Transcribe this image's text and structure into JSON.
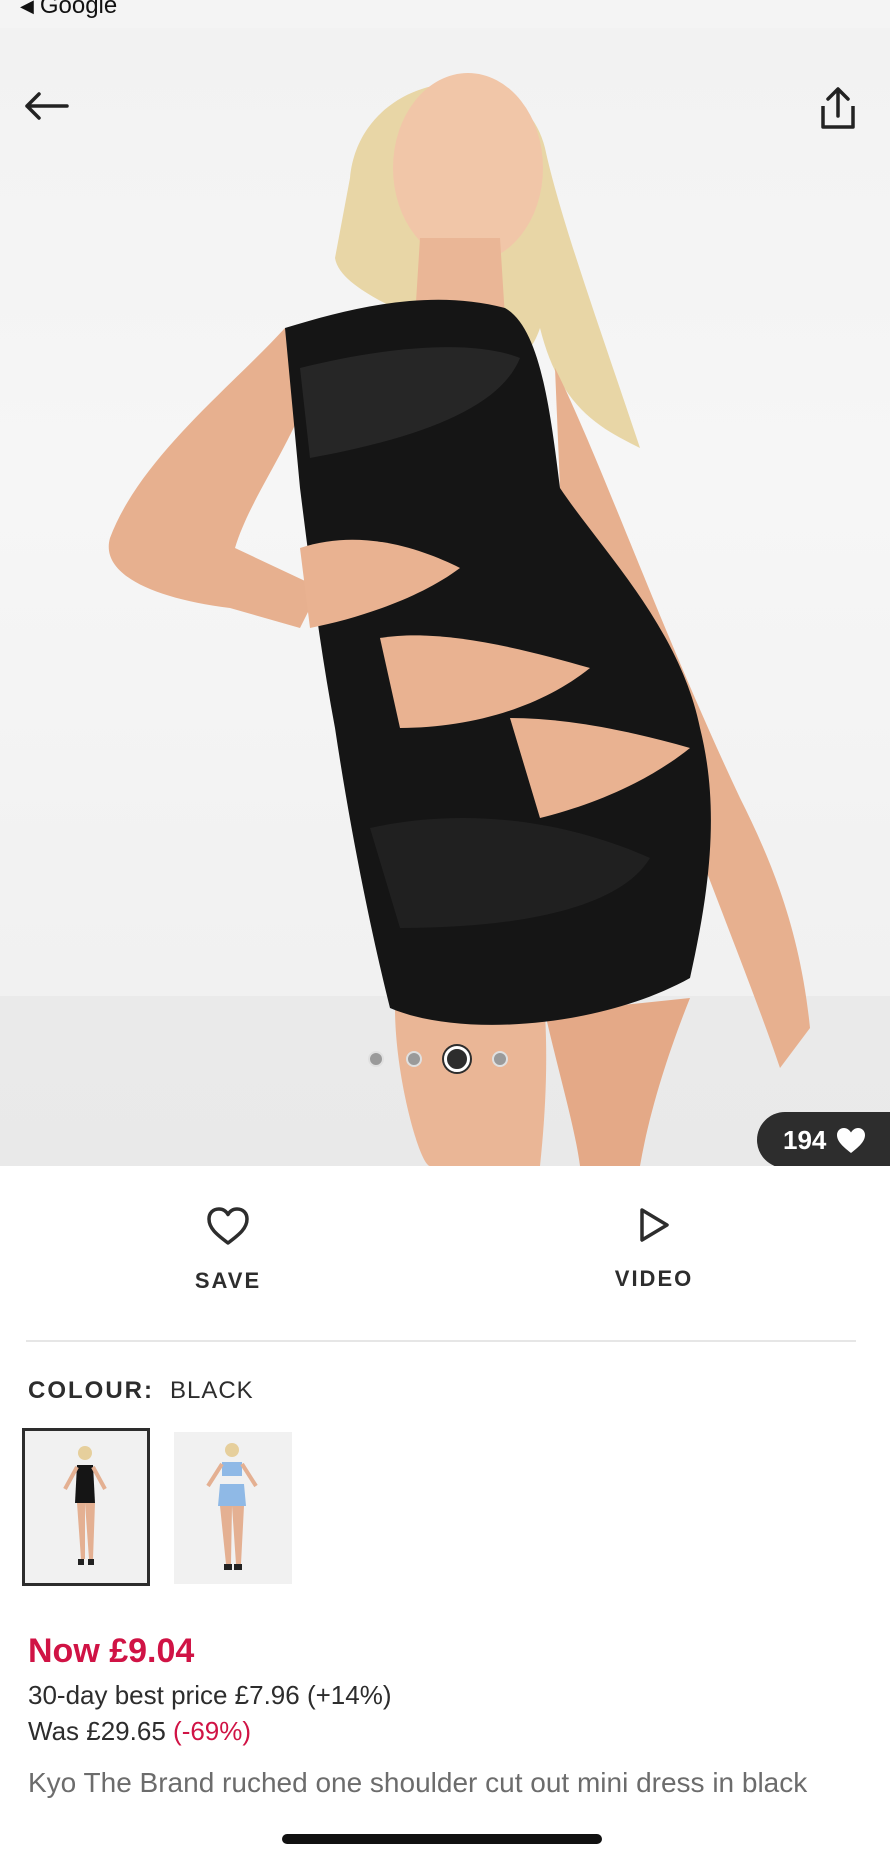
{
  "status_bar": {
    "back_app_label": "Google"
  },
  "hero": {
    "likes_count": "194",
    "carousel": {
      "total": 4,
      "active_index": 2
    }
  },
  "actions": {
    "save_label": "SAVE",
    "video_label": "VIDEO"
  },
  "colour": {
    "label": "COLOUR:",
    "value": "BLACK"
  },
  "price": {
    "now": "Now £9.04",
    "best_price": "30-day best price £7.96 (+14%)",
    "was_prefix": "Was £29.65",
    "was_discount": "(-69%)"
  },
  "product": {
    "title": "Kyo The Brand ruched one shoulder cut out mini dress in black"
  },
  "colors": {
    "accent_red": "#d01345",
    "text_dark": "#2d2d2d",
    "text_muted": "#6c6c6c"
  },
  "icons": [
    "arrow-left-icon",
    "share-icon",
    "heart-icon",
    "play-icon"
  ]
}
